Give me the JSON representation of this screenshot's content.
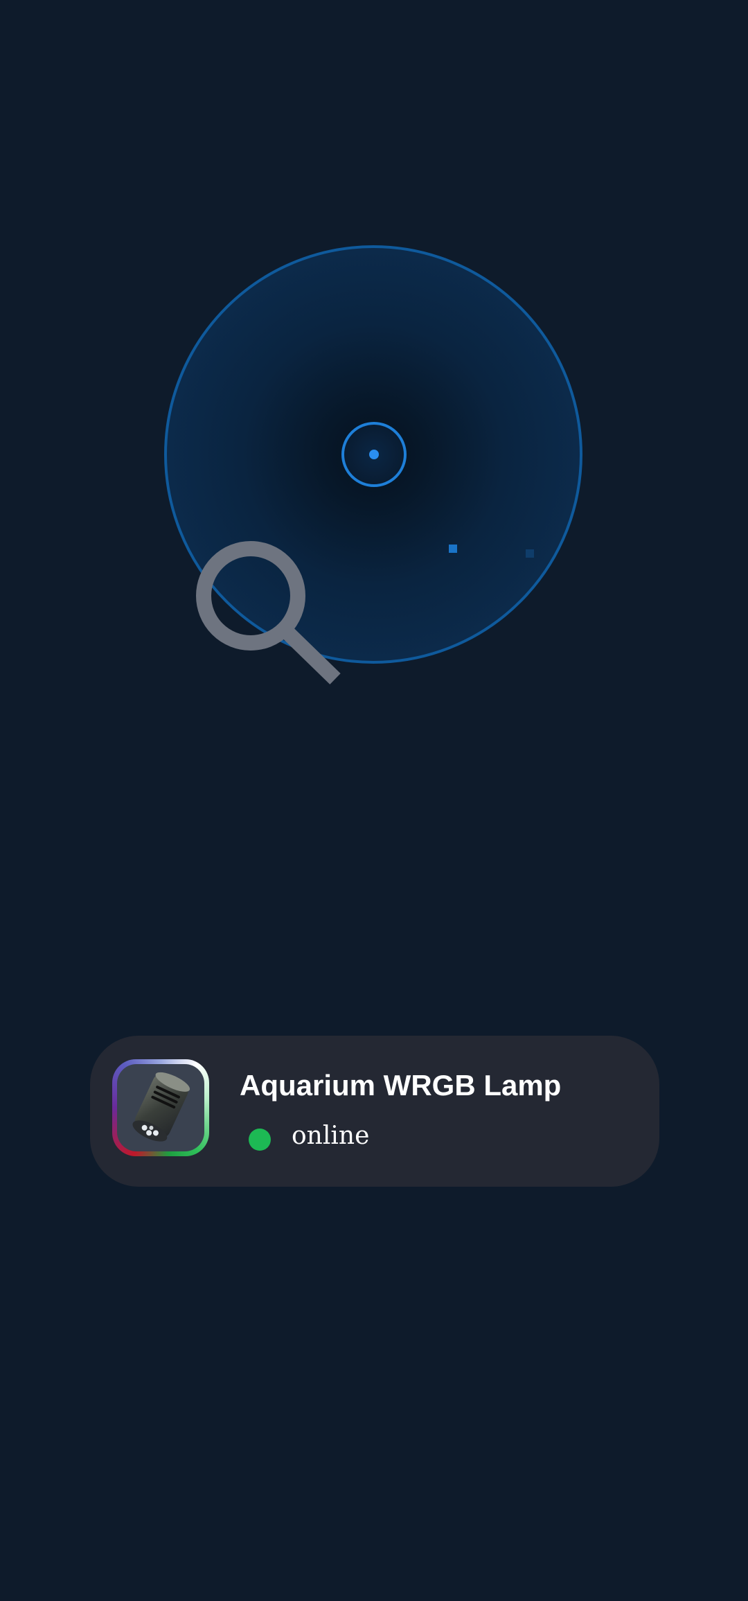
{
  "scanner": {
    "state": "scanning"
  },
  "device": {
    "name": "Aquarium WRGB Lamp",
    "status": "online",
    "icon": "aquarium-lamp-icon"
  },
  "colors": {
    "background": "#0e1b2b",
    "radar_ring": "#0f5a9c",
    "radar_center": "#1e7fd8",
    "card_background": "#242833",
    "status_online": "#1db954",
    "search_icon": "#6e7480"
  }
}
